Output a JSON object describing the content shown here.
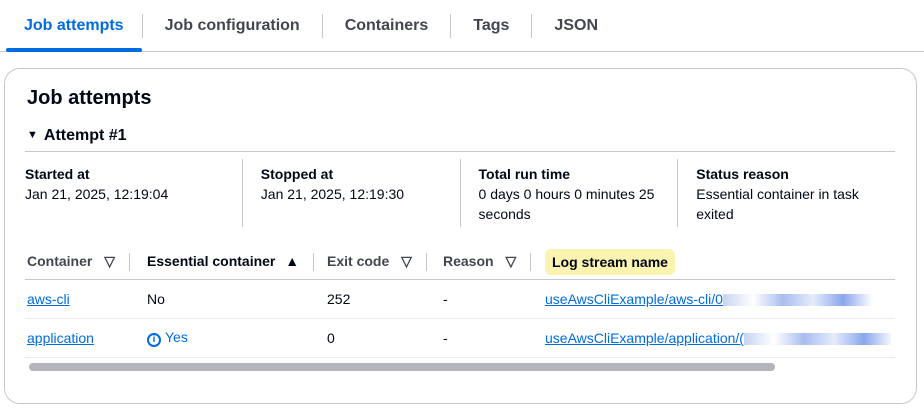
{
  "tabs": [
    "Job attempts",
    "Job configuration",
    "Containers",
    "Tags",
    "JSON"
  ],
  "section_title": "Job attempts",
  "attempt_label": "Attempt #1",
  "details": [
    {
      "k": "Started at",
      "v": "Jan 21, 2025, 12:19:04"
    },
    {
      "k": "Stopped at",
      "v": "Jan 21, 2025, 12:19:30"
    },
    {
      "k": "Total run time",
      "v": "0 days 0 hours 0 minutes 25 seconds"
    },
    {
      "k": "Status reason",
      "v": "Essential container in task exited"
    }
  ],
  "columns": [
    "Container",
    "Essential container",
    "Exit code",
    "Reason",
    "Log stream name"
  ],
  "rows": [
    {
      "container": "aws-cli",
      "essential": "No",
      "exit": "252",
      "reason": "-",
      "log": "useAwsCliExample/aws-cli/0"
    },
    {
      "container": "application",
      "essential": "Yes",
      "exit": "0",
      "reason": "-",
      "log": "useAwsCliExample/application/("
    }
  ]
}
